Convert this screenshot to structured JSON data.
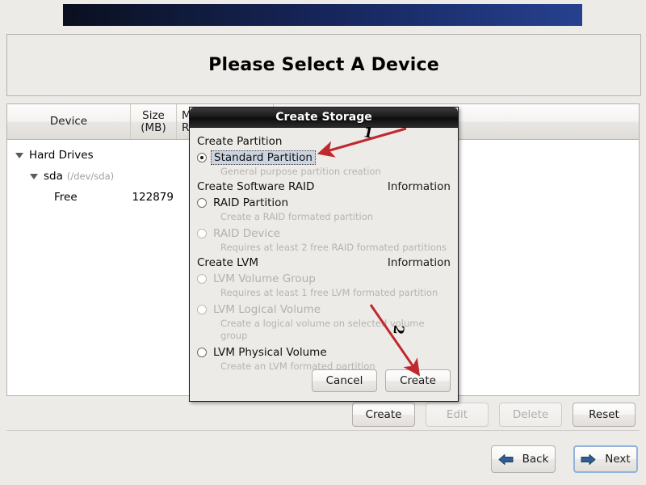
{
  "page": {
    "title": "Please Select A Device"
  },
  "device_table": {
    "columns": [
      "Device",
      "Size\n(MB)",
      "Mo\nRA"
    ],
    "col_device": "Device",
    "col_size_line1": "Size",
    "col_size_line2": "(MB)",
    "col_third_line1": "Mo",
    "col_third_line2": "RA",
    "rows": [
      {
        "label": "Hard Drives",
        "path": "",
        "size": "",
        "indent": 1,
        "expander": "triangle-down"
      },
      {
        "label": "sda",
        "path": "(/dev/sda)",
        "size": "",
        "indent": 2,
        "expander": "triangle-down"
      },
      {
        "label": "Free",
        "path": "",
        "size": "122879",
        "indent": 3,
        "expander": ""
      }
    ]
  },
  "toolbar": {
    "create_label": "Create",
    "edit_label": "Edit",
    "delete_label": "Delete",
    "reset_label": "Reset"
  },
  "nav": {
    "back_label": "Back",
    "next_label": "Next",
    "back_icon": "arrow-left-icon",
    "next_icon": "arrow-right-icon"
  },
  "dialog": {
    "title": "Create Storage",
    "groups": [
      {
        "heading": "Create Partition",
        "info": "",
        "options": [
          {
            "label": "Standard Partition",
            "desc": "General purpose partition creation",
            "selected": true,
            "enabled": true,
            "focused": true
          }
        ]
      },
      {
        "heading": "Create Software RAID",
        "info": "Information",
        "options": [
          {
            "label": "RAID Partition",
            "desc": "Create a RAID formated partition",
            "selected": false,
            "enabled": true,
            "focused": false
          },
          {
            "label": "RAID Device",
            "desc": "Requires at least 2 free RAID formated partitions",
            "selected": false,
            "enabled": false,
            "focused": false
          }
        ]
      },
      {
        "heading": "Create LVM",
        "info": "Information",
        "options": [
          {
            "label": "LVM Volume Group",
            "desc": "Requires at least 1 free LVM formated partition",
            "selected": false,
            "enabled": false,
            "focused": false
          },
          {
            "label": "LVM Logical Volume",
            "desc": "Create a logical volume on selected volume group",
            "selected": false,
            "enabled": false,
            "focused": false
          },
          {
            "label": "LVM Physical Volume",
            "desc": "Create an LVM formated partition",
            "selected": false,
            "enabled": true,
            "focused": false
          }
        ]
      }
    ],
    "cancel_label": "Cancel",
    "create_label": "Create"
  },
  "annotations": {
    "color": "#c0282d",
    "items": [
      {
        "number": "1",
        "target": "standard-partition-option"
      },
      {
        "number": "2",
        "target": "dialog-create-button"
      }
    ]
  },
  "colors": {
    "window_bg": "#edebe8",
    "banner_dark": "#0a0f1f",
    "banner_light": "#27418f",
    "focus_blue": "#8fb3dd",
    "annotation_red": "#c0282d"
  }
}
